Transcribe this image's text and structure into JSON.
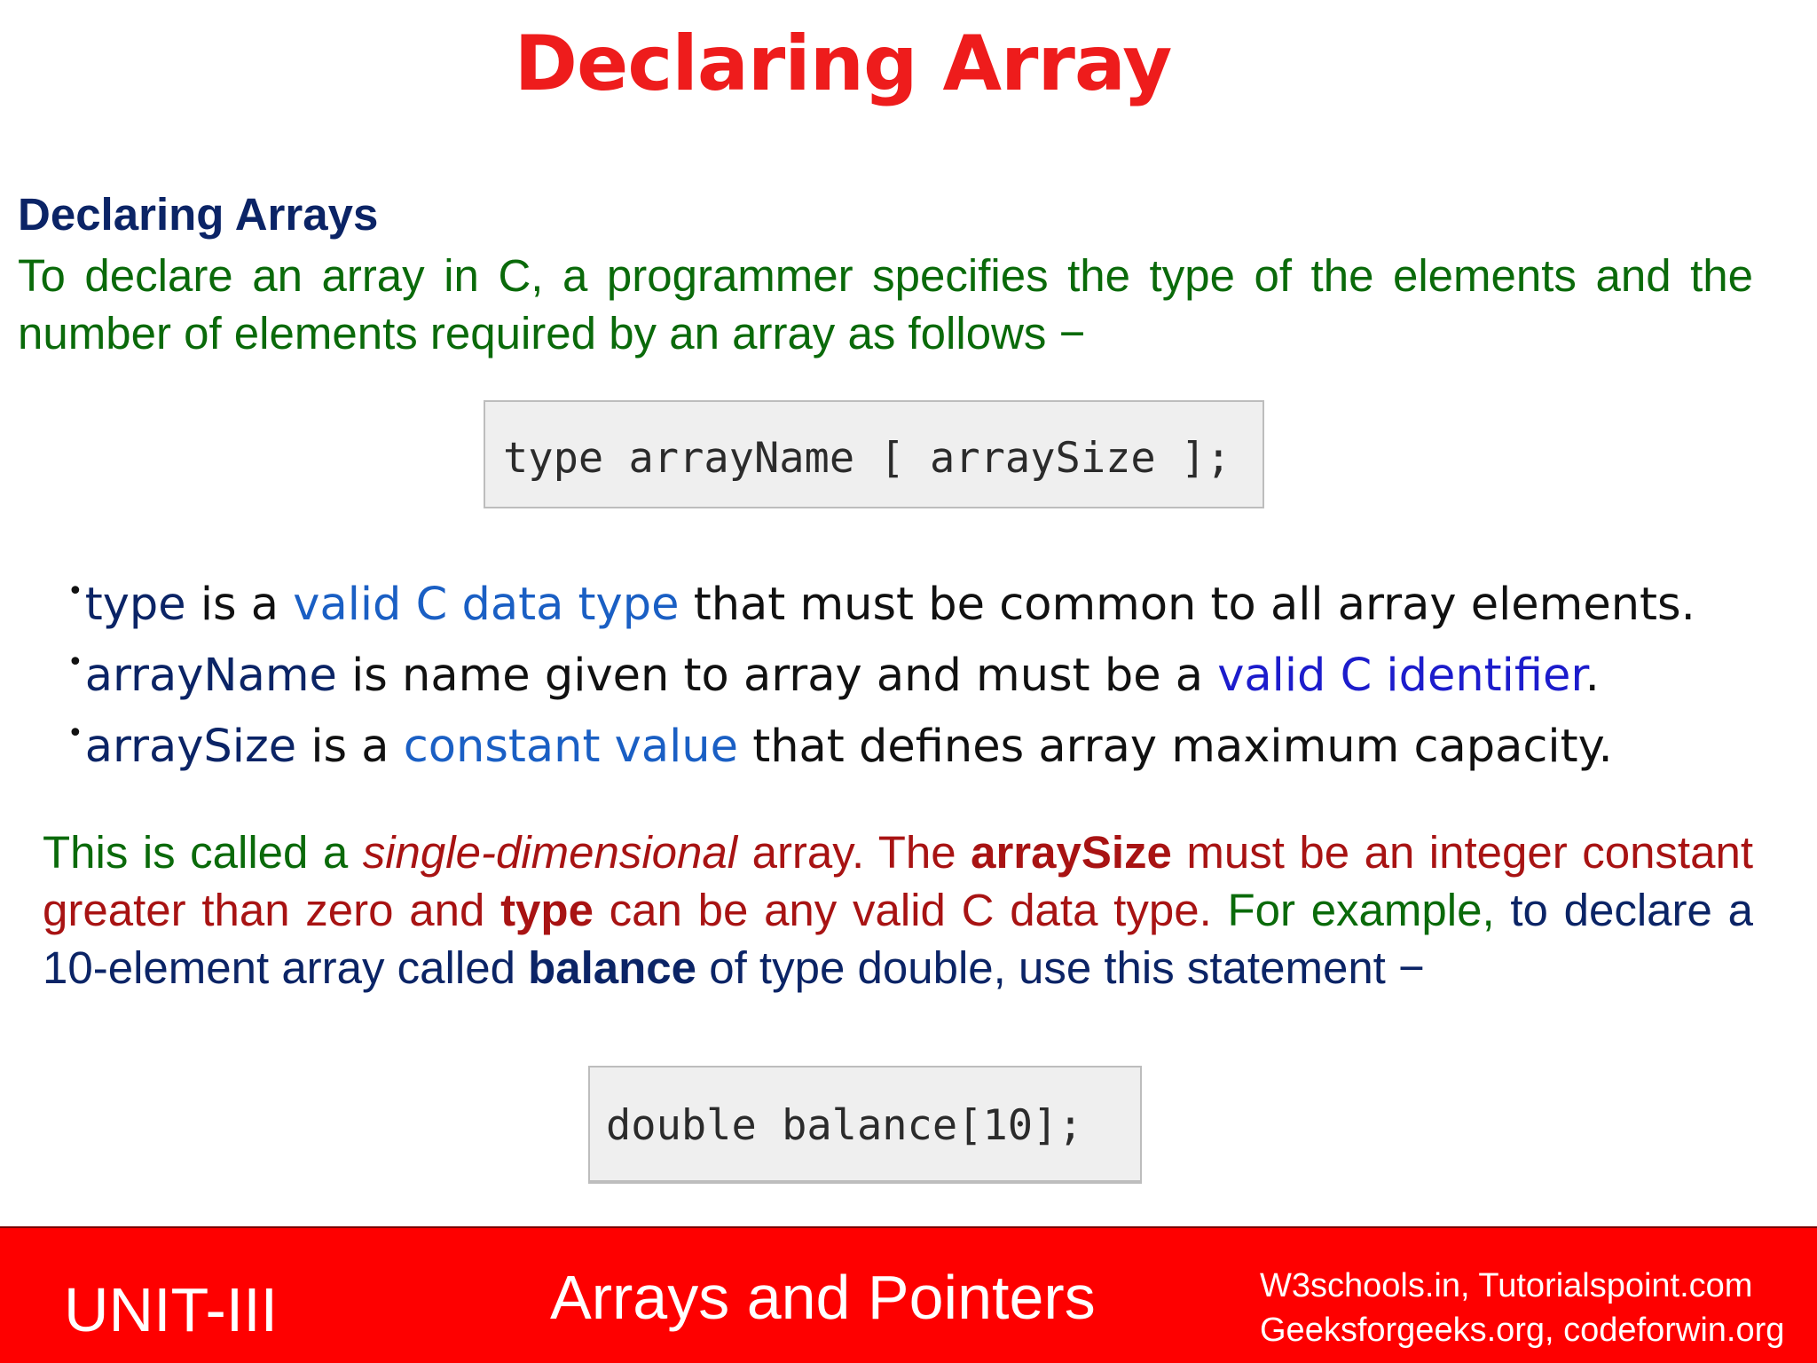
{
  "title": "Declaring Array",
  "heading": "Declaring Arrays",
  "intro": "To declare an array in C, a programmer specifies the type of the elements and the number of elements required by an array as follows −",
  "code_syntax": "type arrayName [ arraySize ];",
  "bullets": [
    {
      "term": "type",
      "t1": " is a ",
      "link": "valid C data type",
      "t2": " that must be common to all array elements."
    },
    {
      "term": "arrayName",
      "t1": " is name given to array and must be a ",
      "link": "valid C identifier",
      "t2": "."
    },
    {
      "term": "arraySize",
      "t1": " is a ",
      "link": "constant value",
      "t2": " that defines array maximum capacity."
    }
  ],
  "bullet_char": "•",
  "paragraph": {
    "p1": "This is called a ",
    "p2": "single-dimensional",
    "p3": " array. The ",
    "p4": "arraySize",
    "p5": " must be an integer constant greater than zero and ",
    "p6": "type",
    "p7": " can be any valid C data type. ",
    "p8": "For example,",
    "p9": " to declare a 10-element array called ",
    "p10": "balance",
    "p11": " of type double, use this statement −"
  },
  "code_example": "double balance[10];",
  "footer": {
    "unit": "UNIT-III",
    "title": "Arrays and Pointers",
    "sources_line1": "W3schools.in, Tutorialspoint.com",
    "sources_line2": "Geeksforgeeks.org, codeforwin.org"
  },
  "colors": {
    "title": "#ee1c1c",
    "heading": "#0b2466",
    "green_text": "#0a6a0a",
    "dark_red_text": "#a81313",
    "link_blue": "#1a5fc4",
    "footer_bg": "#fe0000"
  }
}
